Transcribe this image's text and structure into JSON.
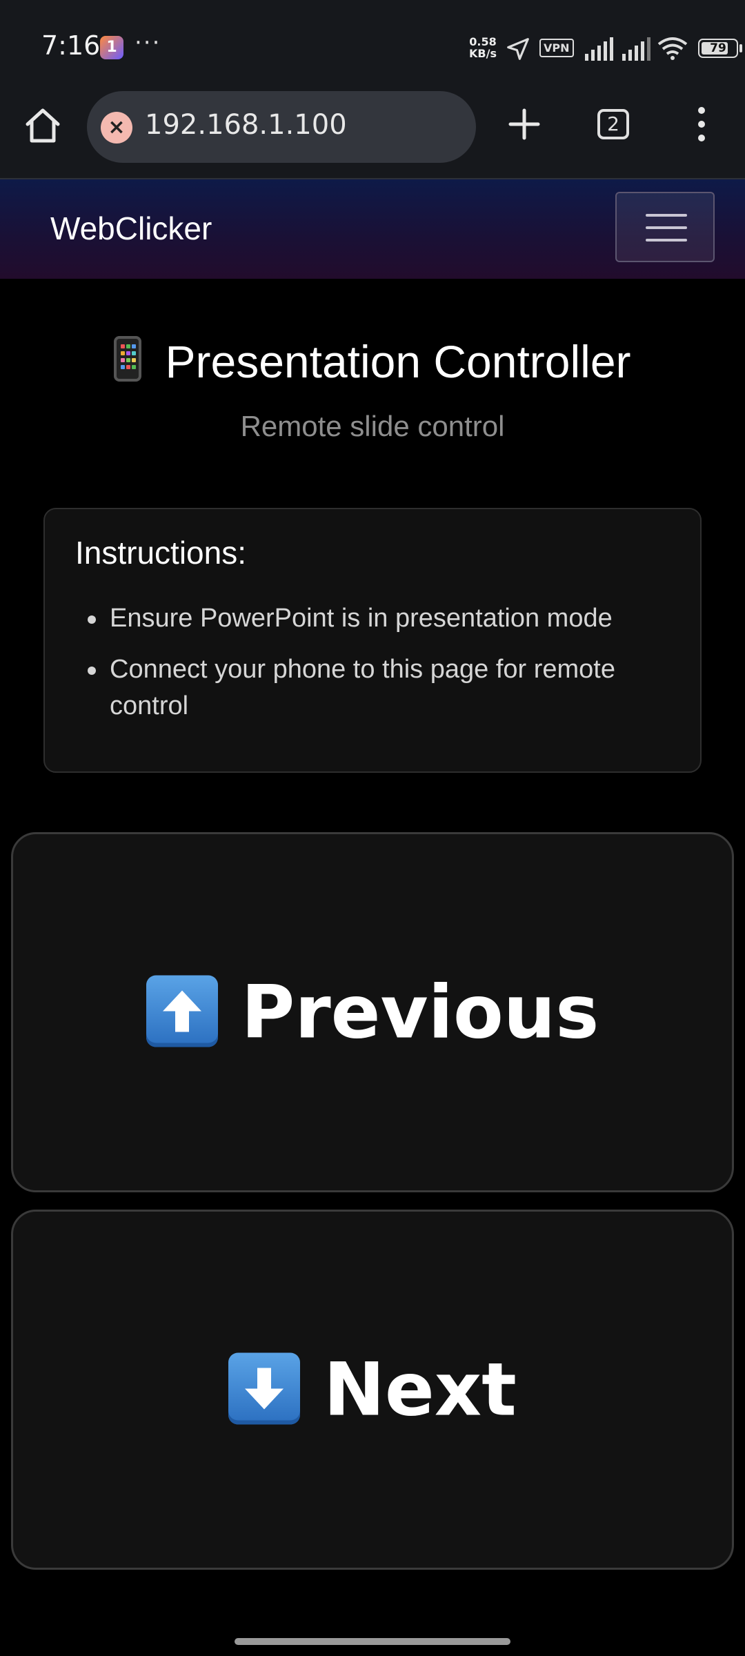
{
  "status_bar": {
    "time": "7:16",
    "app_icon_label": "1",
    "more": "···",
    "net_speed_value": "0.58",
    "net_speed_unit": "KB/s",
    "vpn_label": "VPN",
    "battery_level": "79",
    "battery_fraction": 0.79,
    "dot_color": "#3ddc53"
  },
  "browser": {
    "url": "192.168.1.100",
    "tab_count": "2",
    "url_icon": "close-x-icon"
  },
  "navbar": {
    "brand": "WebClicker",
    "toggler_icon": "hamburger-icon"
  },
  "main": {
    "title": "Presentation Controller",
    "title_icon": "mobile-phone-icon",
    "subtitle": "Remote slide control",
    "instructions": {
      "heading": "Instructions:",
      "items": [
        "Ensure PowerPoint is in presentation mode",
        "Connect your phone to this page for remote control"
      ]
    },
    "buttons": {
      "previous": "Previous",
      "previous_icon": "up-arrow-icon",
      "next": "Next",
      "next_icon": "down-arrow-icon"
    }
  },
  "colors": {
    "background": "#000000",
    "card": "#111111",
    "navbar_start": "#0e1a48",
    "navbar_end": "#220c2c"
  }
}
